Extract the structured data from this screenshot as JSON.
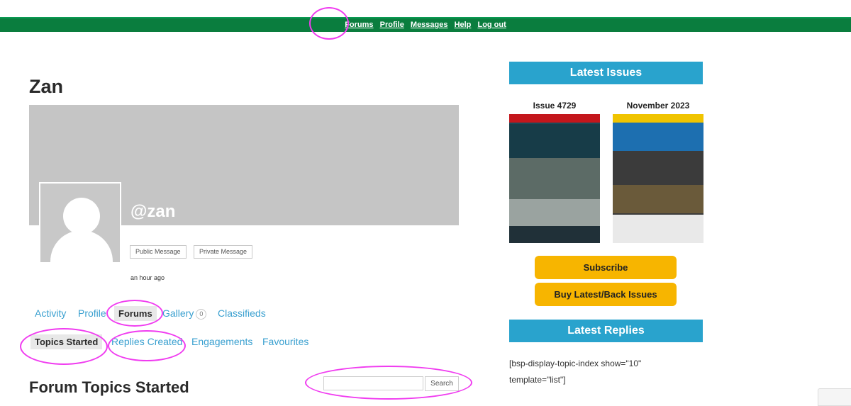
{
  "topnav": {
    "items": [
      "Forums",
      "Profile",
      "Messages",
      "Help",
      "Log out"
    ]
  },
  "profile": {
    "display_name": "Zan",
    "handle": "@zan",
    "public_message_label": "Public Message",
    "private_message_label": "Private Message",
    "last_active": "an hour ago"
  },
  "tabs": {
    "activity": "Activity",
    "profile": "Profile",
    "forums": "Forums",
    "gallery": "Gallery",
    "gallery_count": "0",
    "classifieds": "Classifieds"
  },
  "subtabs": {
    "topics_started": "Topics Started",
    "replies_created": "Replies Created",
    "engagements": "Engagements",
    "favourites": "Favourites"
  },
  "main": {
    "section_title": "Forum Topics Started",
    "search_value": "",
    "search_button": "Search"
  },
  "sidebar": {
    "latest_issues_title": "Latest Issues",
    "issue1_label": "Issue 4729",
    "issue2_label": "November 2023",
    "subscribe_label": "Subscribe",
    "buy_label": "Buy Latest/Back Issues",
    "latest_replies_title": "Latest Replies",
    "shortcode": "[bsp-display-topic-index show=\"10\" template=\"list\"]"
  },
  "colors": {
    "nav_green": "#0a7d3e",
    "sidebar_blue": "#29a3cd",
    "button_yellow": "#f7b500",
    "link_blue": "#3aa0d0",
    "annotation_magenta": "#f03cf0"
  }
}
